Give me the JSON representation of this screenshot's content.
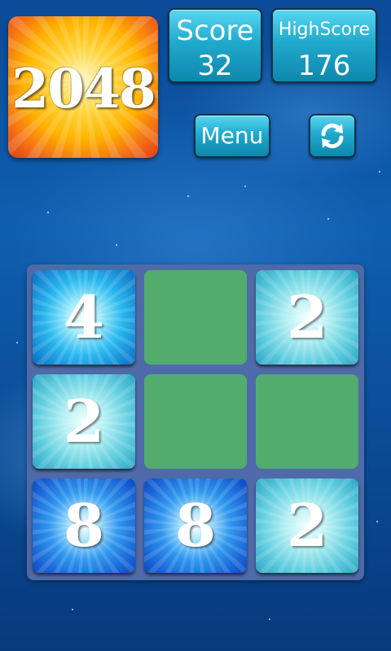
{
  "logo": {
    "text": "2048"
  },
  "score": {
    "label": "Score",
    "value": "32"
  },
  "high_score": {
    "label": "HighScore",
    "value": "176"
  },
  "menu_button": {
    "label": "Menu"
  },
  "restart_button": {
    "icon": "refresh-icon"
  },
  "board": {
    "rows": 3,
    "cols": 3,
    "tiles": [
      [
        "4",
        "",
        "2"
      ],
      [
        "2",
        "",
        ""
      ],
      [
        "8",
        "8",
        "2"
      ]
    ]
  },
  "colors": {
    "board": "#4f6aa8",
    "empty_cell": "#52ac6e",
    "panel": "#20aacd"
  }
}
